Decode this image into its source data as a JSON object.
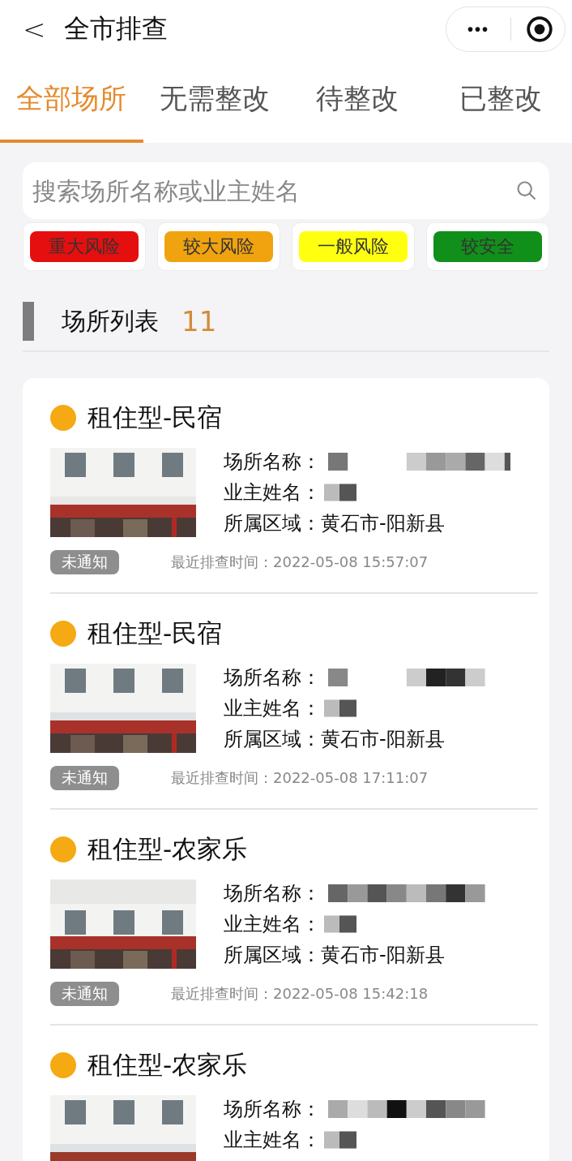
{
  "nav": {
    "back": "<",
    "title": "全市排查",
    "more": "•••"
  },
  "tabs": [
    {
      "label": "全部场所",
      "selected": true
    },
    {
      "label": "无需整改",
      "selected": false
    },
    {
      "label": "待整改",
      "selected": false
    },
    {
      "label": "已整改",
      "selected": false
    }
  ],
  "search": {
    "placeholder": "搜索场所名称或业主姓名"
  },
  "filters": [
    {
      "label": "重大风险",
      "color": "#e60f0f"
    },
    {
      "label": "较大风险",
      "color": "#f0a30f"
    },
    {
      "label": "一般风险",
      "color": "#ffff10"
    },
    {
      "label": "较安全",
      "color": "#10901a"
    }
  ],
  "list": {
    "title": "场所列表",
    "count": "11"
  },
  "places": [
    {
      "type": "租住型-民宿",
      "color": "#f5a912",
      "name_label": "场所名称：",
      "owner_label": "业主姓名：",
      "region_label": "所属区域：",
      "region": "黄石市-阳新县",
      "status": "未通知",
      "time_label": "最近排查时间：",
      "time": "2022-05-08 15:57:07"
    },
    {
      "type": "租住型-民宿",
      "color": "#f5a912",
      "name_label": "场所名称：",
      "owner_label": "业主姓名：",
      "region_label": "所属区域：",
      "region": "黄石市-阳新县",
      "status": "未通知",
      "time_label": "最近排查时间：",
      "time": "2022-05-08 17:11:07"
    },
    {
      "type": "租住型-农家乐",
      "color": "#f5a912",
      "name_label": "场所名称：",
      "owner_label": "业主姓名：",
      "region_label": "所属区域：",
      "region": "黄石市-阳新县",
      "status": "未通知",
      "time_label": "最近排查时间：",
      "time": "2022-05-08 15:42:18"
    },
    {
      "type": "租住型-农家乐",
      "color": "#f5a912",
      "name_label": "场所名称：",
      "owner_label": "业主姓名："
    }
  ]
}
